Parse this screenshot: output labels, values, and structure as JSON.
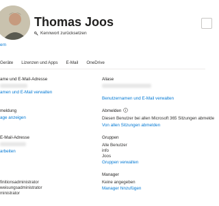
{
  "profile": {
    "name": "Thomas Joos",
    "reset_password": "Kennwort zurücksetzen",
    "avatar_link": "ern"
  },
  "tabs": [
    "Geräte",
    "Lizenzen und Apps",
    "E-Mail",
    "OneDrive"
  ],
  "left": {
    "name_email_label": "ame und E-Mail-Adresse",
    "name_email_link": "amen und E-Mail verwalten",
    "signin_label": "meldung",
    "signin_link": "age anzeigen",
    "email_label": "E-Mail-Adresse",
    "email_link": "arbeiten",
    "roles": [
      "finitionsadministrator",
      "weisungsadministrator",
      "ministrator"
    ]
  },
  "right": {
    "alias_label": "Aliase",
    "alias_link": "Benutzernamen und E-Mail verwalten",
    "signout_label": "Abmelden",
    "signout_text": "Diesen Benutzer bei allen Microsoft 365 Sitzungen abmelde",
    "signout_link": "Von allen Sitzungen abmelden",
    "groups_label": "Gruppen",
    "groups": [
      "Alle Benutzer",
      "info",
      "Joos"
    ],
    "groups_link": "Gruppen verwalten",
    "manager_label": "Manager",
    "manager_value": "Keine angegeben",
    "manager_link": "Manager hinzufügen"
  },
  "colors": {
    "link": "#0078d4",
    "text": "#201f1e",
    "divider": "#edebe9"
  }
}
